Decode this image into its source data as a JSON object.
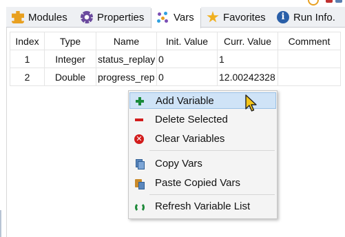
{
  "tabs": [
    {
      "label": "Modules",
      "icon": "puzzle-icon",
      "active": false
    },
    {
      "label": "Properties",
      "icon": "gear-icon",
      "active": false
    },
    {
      "label": "Vars",
      "icon": "dots-icon",
      "active": true
    },
    {
      "label": "Favorites",
      "icon": "star-icon",
      "active": false
    },
    {
      "label": "Run Info.",
      "icon": "info-icon",
      "active": false
    }
  ],
  "table": {
    "columns": [
      "Index",
      "Type",
      "Name",
      "Init. Value",
      "Curr. Value",
      "Comment"
    ],
    "rows": [
      [
        "1",
        "Integer",
        "status_replay",
        "0",
        "1",
        ""
      ],
      [
        "2",
        "Double",
        "progress_rep",
        "0",
        "12.00242328",
        ""
      ]
    ]
  },
  "context_menu": {
    "items": [
      {
        "label": "Add Variable",
        "icon": "add-icon",
        "highlighted": true
      },
      {
        "label": "Delete Selected",
        "icon": "remove-icon",
        "highlighted": false
      },
      {
        "label": "Clear Variables",
        "icon": "clear-icon",
        "highlighted": false
      },
      {
        "label": "Copy Vars",
        "icon": "copy-icon",
        "highlighted": false
      },
      {
        "label": "Paste Copied Vars",
        "icon": "paste-icon",
        "highlighted": false
      },
      {
        "label": "Refresh Variable List",
        "icon": "refresh-icon",
        "highlighted": false
      }
    ]
  },
  "colors": {
    "highlight": "#cfe3f7",
    "add": "#1a8a3a",
    "delete": "#d21c1c",
    "star": "#f0b020",
    "info": "#2a5fa8"
  }
}
